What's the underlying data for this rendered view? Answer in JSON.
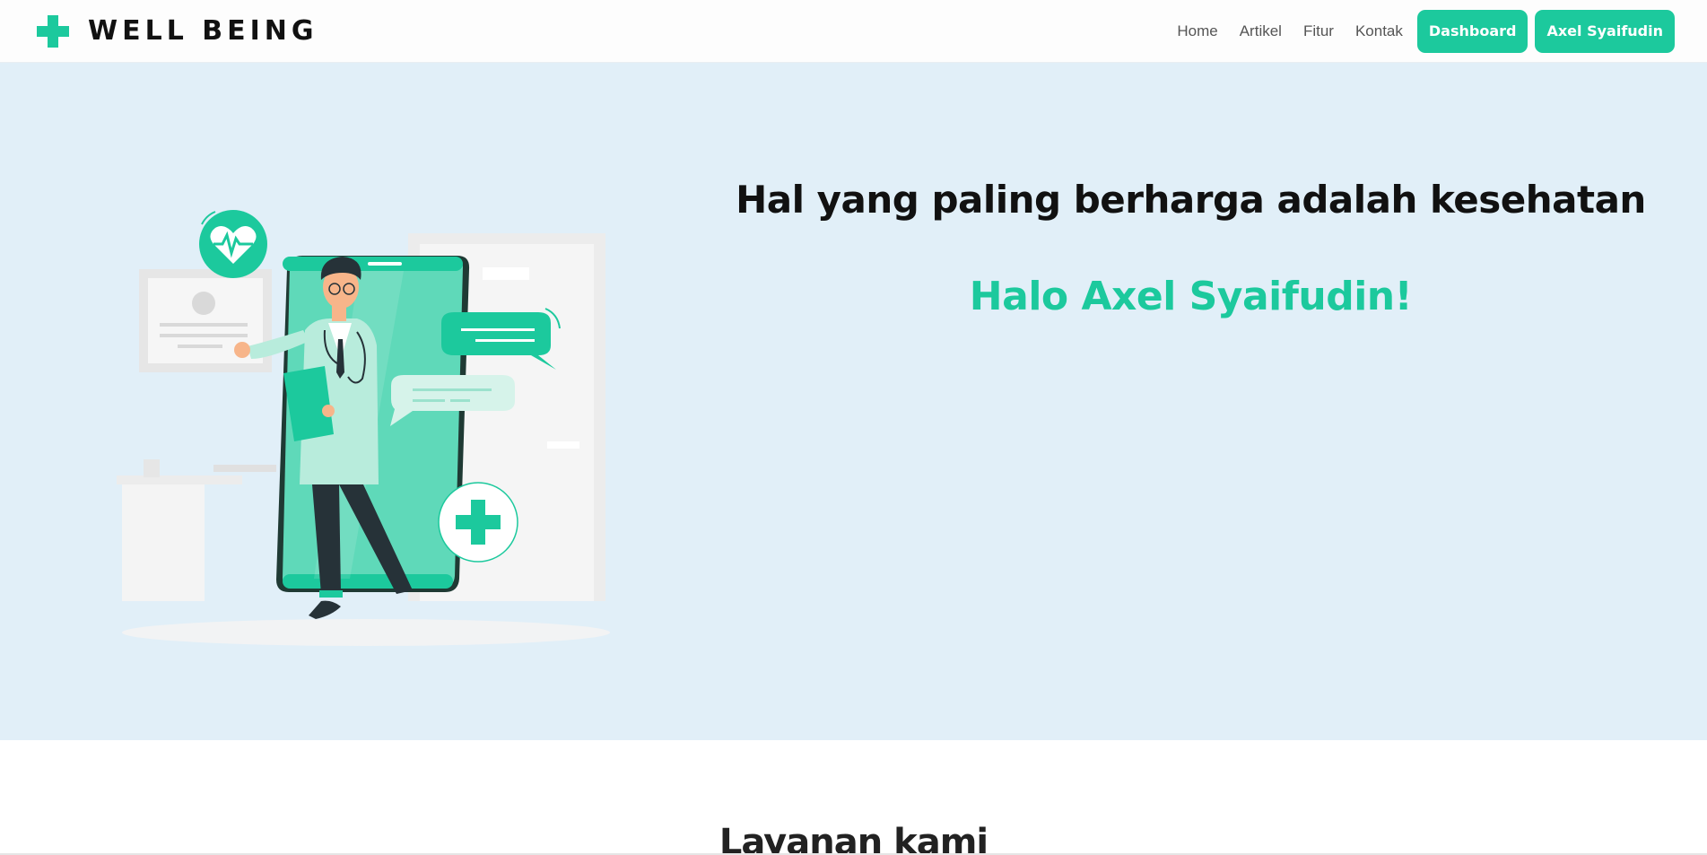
{
  "brand": {
    "name": "WELL BEING",
    "accent": "#1cc99d"
  },
  "nav": {
    "links": [
      "Home",
      "Artikel",
      "Fitur",
      "Kontak"
    ],
    "dashboard": "Dashboard",
    "user": "Axel Syaifudin"
  },
  "hero": {
    "title": "Hal yang paling berharga adalah kesehatan",
    "greeting": "Halo Axel Syaifudin!",
    "background": "#e1eff8"
  },
  "services": {
    "title": "Layanan kami"
  }
}
